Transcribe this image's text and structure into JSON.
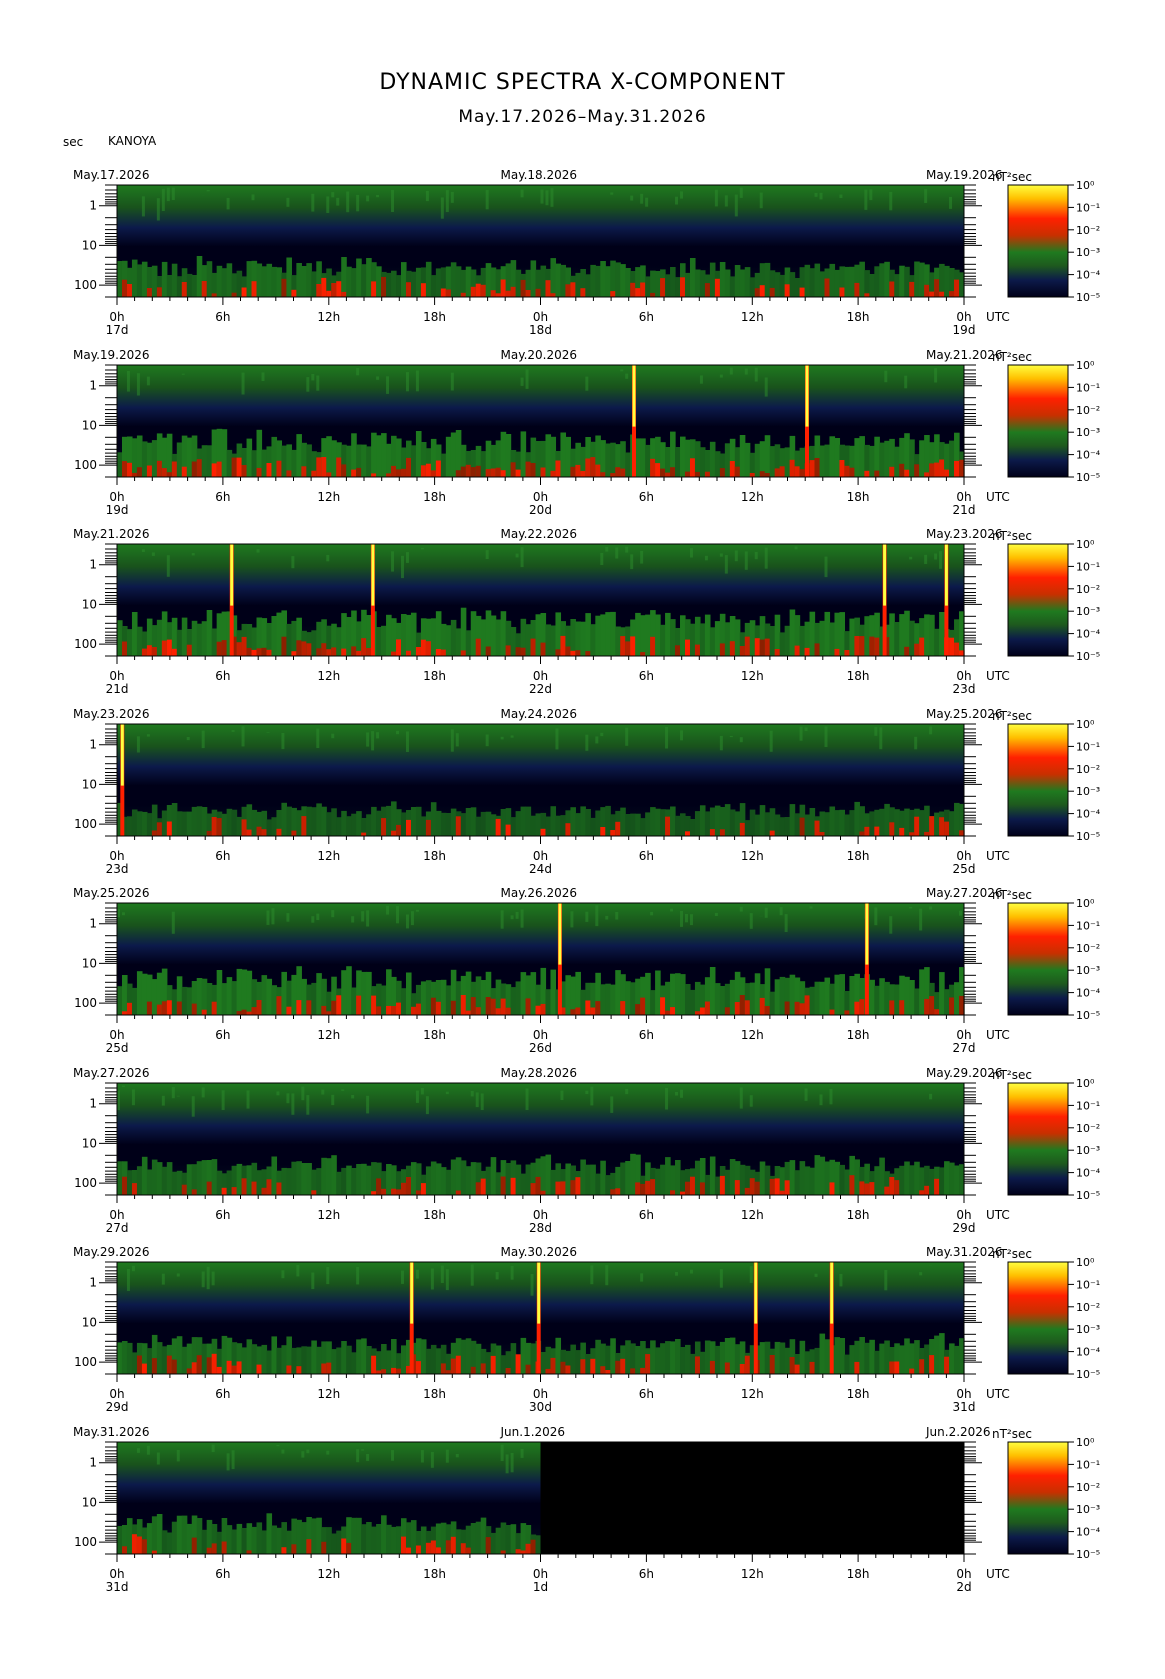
{
  "title": "DYNAMIC SPECTRA X-COMPONENT",
  "subtitle": "May.17.2026–May.31.2026",
  "y_unit": "sec",
  "station": "KANOYA",
  "colorbar_unit": "nT²sec",
  "utc_label": "UTC",
  "colorbar_ticks": [
    "10⁰",
    "10⁻¹",
    "10⁻²",
    "10⁻³",
    "10⁻⁴",
    "10⁻⁵"
  ],
  "colors": {
    "low": "#000018",
    "mid_low": "#0c1a4a",
    "mid": "#1f7a1f",
    "high": "#ff2000",
    "top": "#ffff40",
    "no_data": "#000000"
  },
  "chart_data": {
    "type": "heatmap",
    "y_axis": {
      "label": "sec",
      "scale": "log",
      "range": [
        0.3,
        200
      ],
      "tick_labels": [
        "1",
        "10",
        "100"
      ],
      "inverted": true
    },
    "x_tick_labels": [
      "0h",
      "6h",
      "12h",
      "18h",
      "0h",
      "6h",
      "12h",
      "18h",
      "0h"
    ],
    "colorbar": {
      "label": "nT²sec",
      "scale": "log",
      "range": [
        1e-05,
        1
      ]
    },
    "panels": [
      {
        "left_date": "May.17.2026",
        "mid_date": "May.18.2026",
        "right_date": "May.19.2026",
        "day_labels": [
          "17d",
          "18d",
          "19d"
        ],
        "data_fraction": 1.0,
        "spikes_hour": [],
        "activity": "moderate"
      },
      {
        "left_date": "May.19.2026",
        "mid_date": "May.20.2026",
        "right_date": "May.21.2026",
        "day_labels": [
          "19d",
          "20d",
          "21d"
        ],
        "data_fraction": 1.0,
        "spikes_hour": [
          29.3,
          39.1
        ],
        "activity": "high"
      },
      {
        "left_date": "May.21.2026",
        "mid_date": "May.22.2026",
        "right_date": "May.23.2026",
        "day_labels": [
          "21d",
          "22d",
          "23d"
        ],
        "data_fraction": 1.0,
        "spikes_hour": [
          6.5,
          14.5,
          43.5,
          47.0
        ],
        "activity": "high"
      },
      {
        "left_date": "May.23.2026",
        "mid_date": "May.24.2026",
        "right_date": "May.25.2026",
        "day_labels": [
          "23d",
          "24d",
          "25d"
        ],
        "data_fraction": 1.0,
        "spikes_hour": [
          0.3
        ],
        "activity": "low"
      },
      {
        "left_date": "May.25.2026",
        "mid_date": "May.26.2026",
        "right_date": "May.27.2026",
        "day_labels": [
          "25d",
          "26d",
          "27d"
        ],
        "data_fraction": 1.0,
        "spikes_hour": [
          25.1,
          42.5
        ],
        "activity": "high"
      },
      {
        "left_date": "May.27.2026",
        "mid_date": "May.28.2026",
        "right_date": "May.29.2026",
        "day_labels": [
          "27d",
          "28d",
          "29d"
        ],
        "data_fraction": 1.0,
        "spikes_hour": [],
        "activity": "moderate"
      },
      {
        "left_date": "May.29.2026",
        "mid_date": "May.30.2026",
        "right_date": "May.31.2026",
        "day_labels": [
          "29d",
          "30d",
          "31d"
        ],
        "data_fraction": 1.0,
        "spikes_hour": [
          16.7,
          23.9,
          36.2,
          40.5
        ],
        "activity": "moderate"
      },
      {
        "left_date": "May.31.2026",
        "mid_date": "Jun.1.2026",
        "right_date": "Jun.2.2026",
        "day_labels": [
          "31d",
          "1d",
          "2d"
        ],
        "data_fraction": 0.5,
        "spikes_hour": [],
        "activity": "moderate"
      }
    ]
  }
}
